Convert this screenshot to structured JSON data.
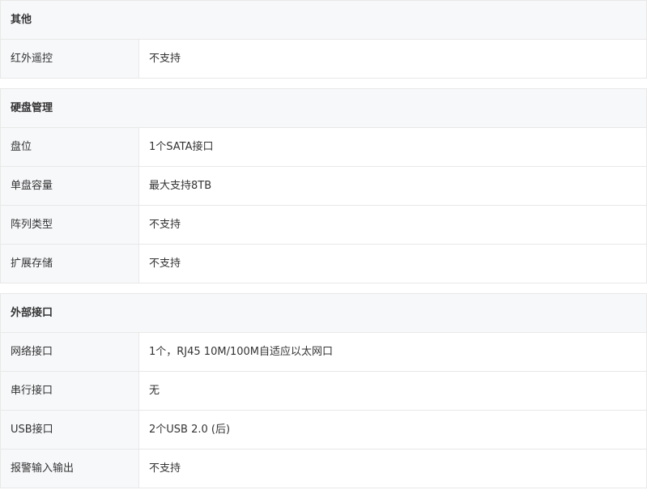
{
  "sections": [
    {
      "title": "其他",
      "rows": [
        {
          "label": "红外遥控",
          "value": "不支持"
        }
      ]
    },
    {
      "title": "硬盘管理",
      "rows": [
        {
          "label": "盘位",
          "value": "1个SATA接口"
        },
        {
          "label": "单盘容量",
          "value": "最大支持8TB"
        },
        {
          "label": "阵列类型",
          "value": "不支持"
        },
        {
          "label": "扩展存储",
          "value": "不支持"
        }
      ]
    },
    {
      "title": "外部接口",
      "rows": [
        {
          "label": "网络接口",
          "value": "1个，RJ45 10M/100M自适应以太网口"
        },
        {
          "label": "串行接口",
          "value": "无"
        },
        {
          "label": "USB接口",
          "value": "2个USB 2.0 (后)"
        },
        {
          "label": "报警输入输出",
          "value": "不支持"
        }
      ]
    }
  ]
}
